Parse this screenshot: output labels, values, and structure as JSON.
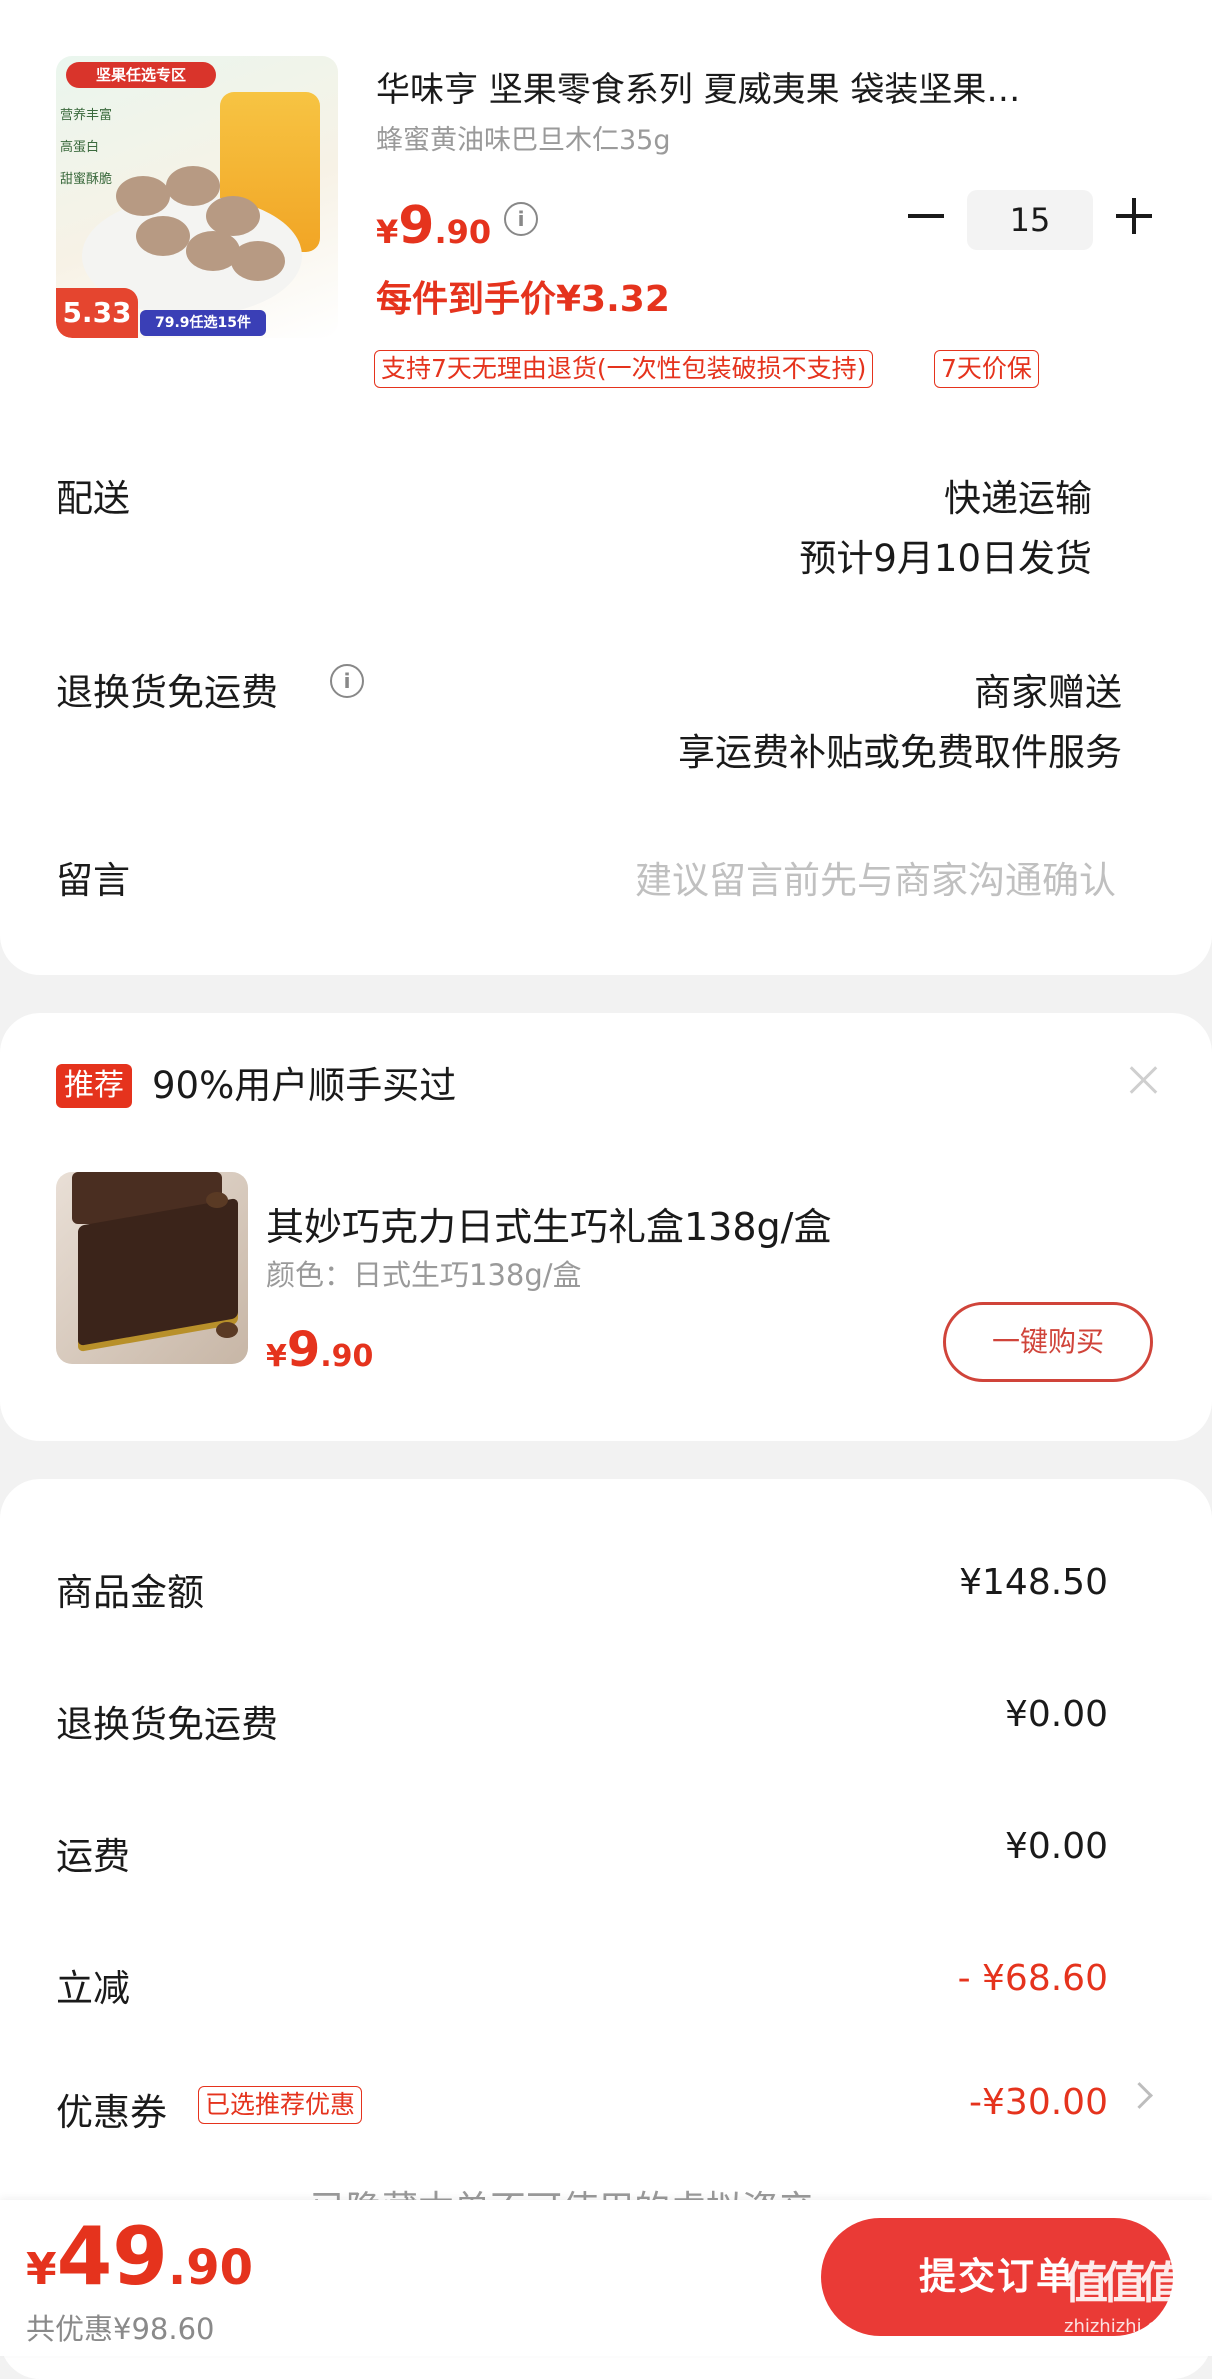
{
  "product": {
    "image_tag": "坚果任选专区",
    "image_side_labels": [
      "营养丰富",
      "高蛋白",
      "甜蜜酥脆"
    ],
    "image_badge_price": "5.33",
    "image_badge_promo": "79.9任选15件",
    "title": "华味亨 坚果零食系列 夏威夷果 袋装坚果…",
    "spec": "蜂蜜黄油味巴旦木仁35g",
    "price_currency": "¥",
    "price_int": "9",
    "price_dec": ".90",
    "hand_price": "每件到手价¥3.32",
    "quantity": "15",
    "badges": [
      "支持7天无理由退货(一次性包装破损不支持)",
      "7天价保"
    ]
  },
  "delivery": {
    "label": "配送",
    "method": "快递运输",
    "eta": "预计9月10日发货"
  },
  "return_shipping": {
    "label": "退换货免运费",
    "value1": "商家赠送",
    "value2": "享运费补贴或免费取件服务"
  },
  "message": {
    "label": "留言",
    "placeholder": "建议留言前先与商家沟通确认"
  },
  "recommendation": {
    "badge": "推荐",
    "title": "90%用户顺手买过",
    "item_name": "其妙巧克力日式生巧礼盒138g/盒",
    "item_spec": "颜色：日式生巧138g/盒",
    "price_currency": "¥",
    "price_int": "9",
    "price_dec": ".90",
    "buy_label": "一键购买"
  },
  "summary": {
    "rows": [
      {
        "label": "商品金额",
        "value": "¥148.50"
      },
      {
        "label": "退换货免运费",
        "value": "¥0.00"
      },
      {
        "label": "运费",
        "value": "¥0.00"
      },
      {
        "label": "立减",
        "value": "- ¥68.60"
      },
      {
        "label": "优惠券",
        "value": "-¥30.00"
      }
    ],
    "coupon_tag": "已选推荐优惠",
    "hidden_assets_text": "已隐藏本单不可使用的虚拟资产"
  },
  "footer": {
    "total_currency": "¥",
    "total_int": "49",
    "total_dec": ".90",
    "saved": "共优惠¥98.60",
    "submit_label": "提交订单"
  },
  "watermark": {
    "logo": "值值值",
    "url": "zhizhizhi.com"
  },
  "colors": {
    "accent": "#e5331d",
    "submit_button": "#ea3a36",
    "background": "#f2f2f2"
  }
}
